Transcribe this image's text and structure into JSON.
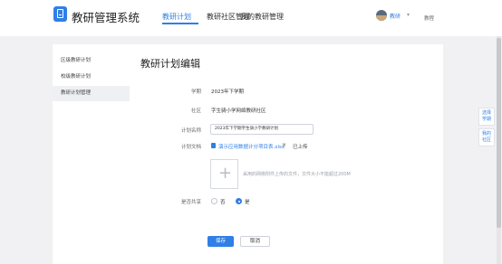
{
  "header": {
    "app_title": "教研管理系统",
    "nav": [
      {
        "label": "教研计划",
        "active": true
      },
      {
        "label": "教研社区管理",
        "active": false
      },
      {
        "label": "我的教研管理",
        "active": false
      }
    ],
    "user_name": "教研",
    "user_caret": "▾",
    "help_link": "教程"
  },
  "sidebar": {
    "items": [
      {
        "label": "区级教研计划",
        "active": false
      },
      {
        "label": "校级教研计划",
        "active": false
      },
      {
        "label": "教研计划管理",
        "active": true
      }
    ]
  },
  "form": {
    "title": "教研计划编辑",
    "semester_label": "学期",
    "semester_value": "2023年下学期",
    "community_label": "社区",
    "community_value": "字生骑小学网络教研社区",
    "plan_name_label": "计划名称",
    "plan_name_value": "2023年下学期字生骑小学教研计划",
    "plan_doc_label": "计划文档",
    "file_name": "演示应用数据计分项目表.xlsx",
    "file_remove": "×",
    "file_status": "已上传",
    "upload_plus": "+",
    "upload_hint": "采用的网络附件上传的文件，文件大小不能超过200M",
    "share_label": "是否共享",
    "radio_no": "否",
    "radio_yes": "是",
    "radio_selected": "是",
    "save_label": "保存",
    "cancel_label": "取消"
  },
  "float_panel": {
    "top": [
      "选择",
      "学期"
    ],
    "bottom": [
      "我的",
      "社区"
    ]
  },
  "colors": {
    "accent": "#2f7fe6",
    "background": "#f1f1f3"
  }
}
